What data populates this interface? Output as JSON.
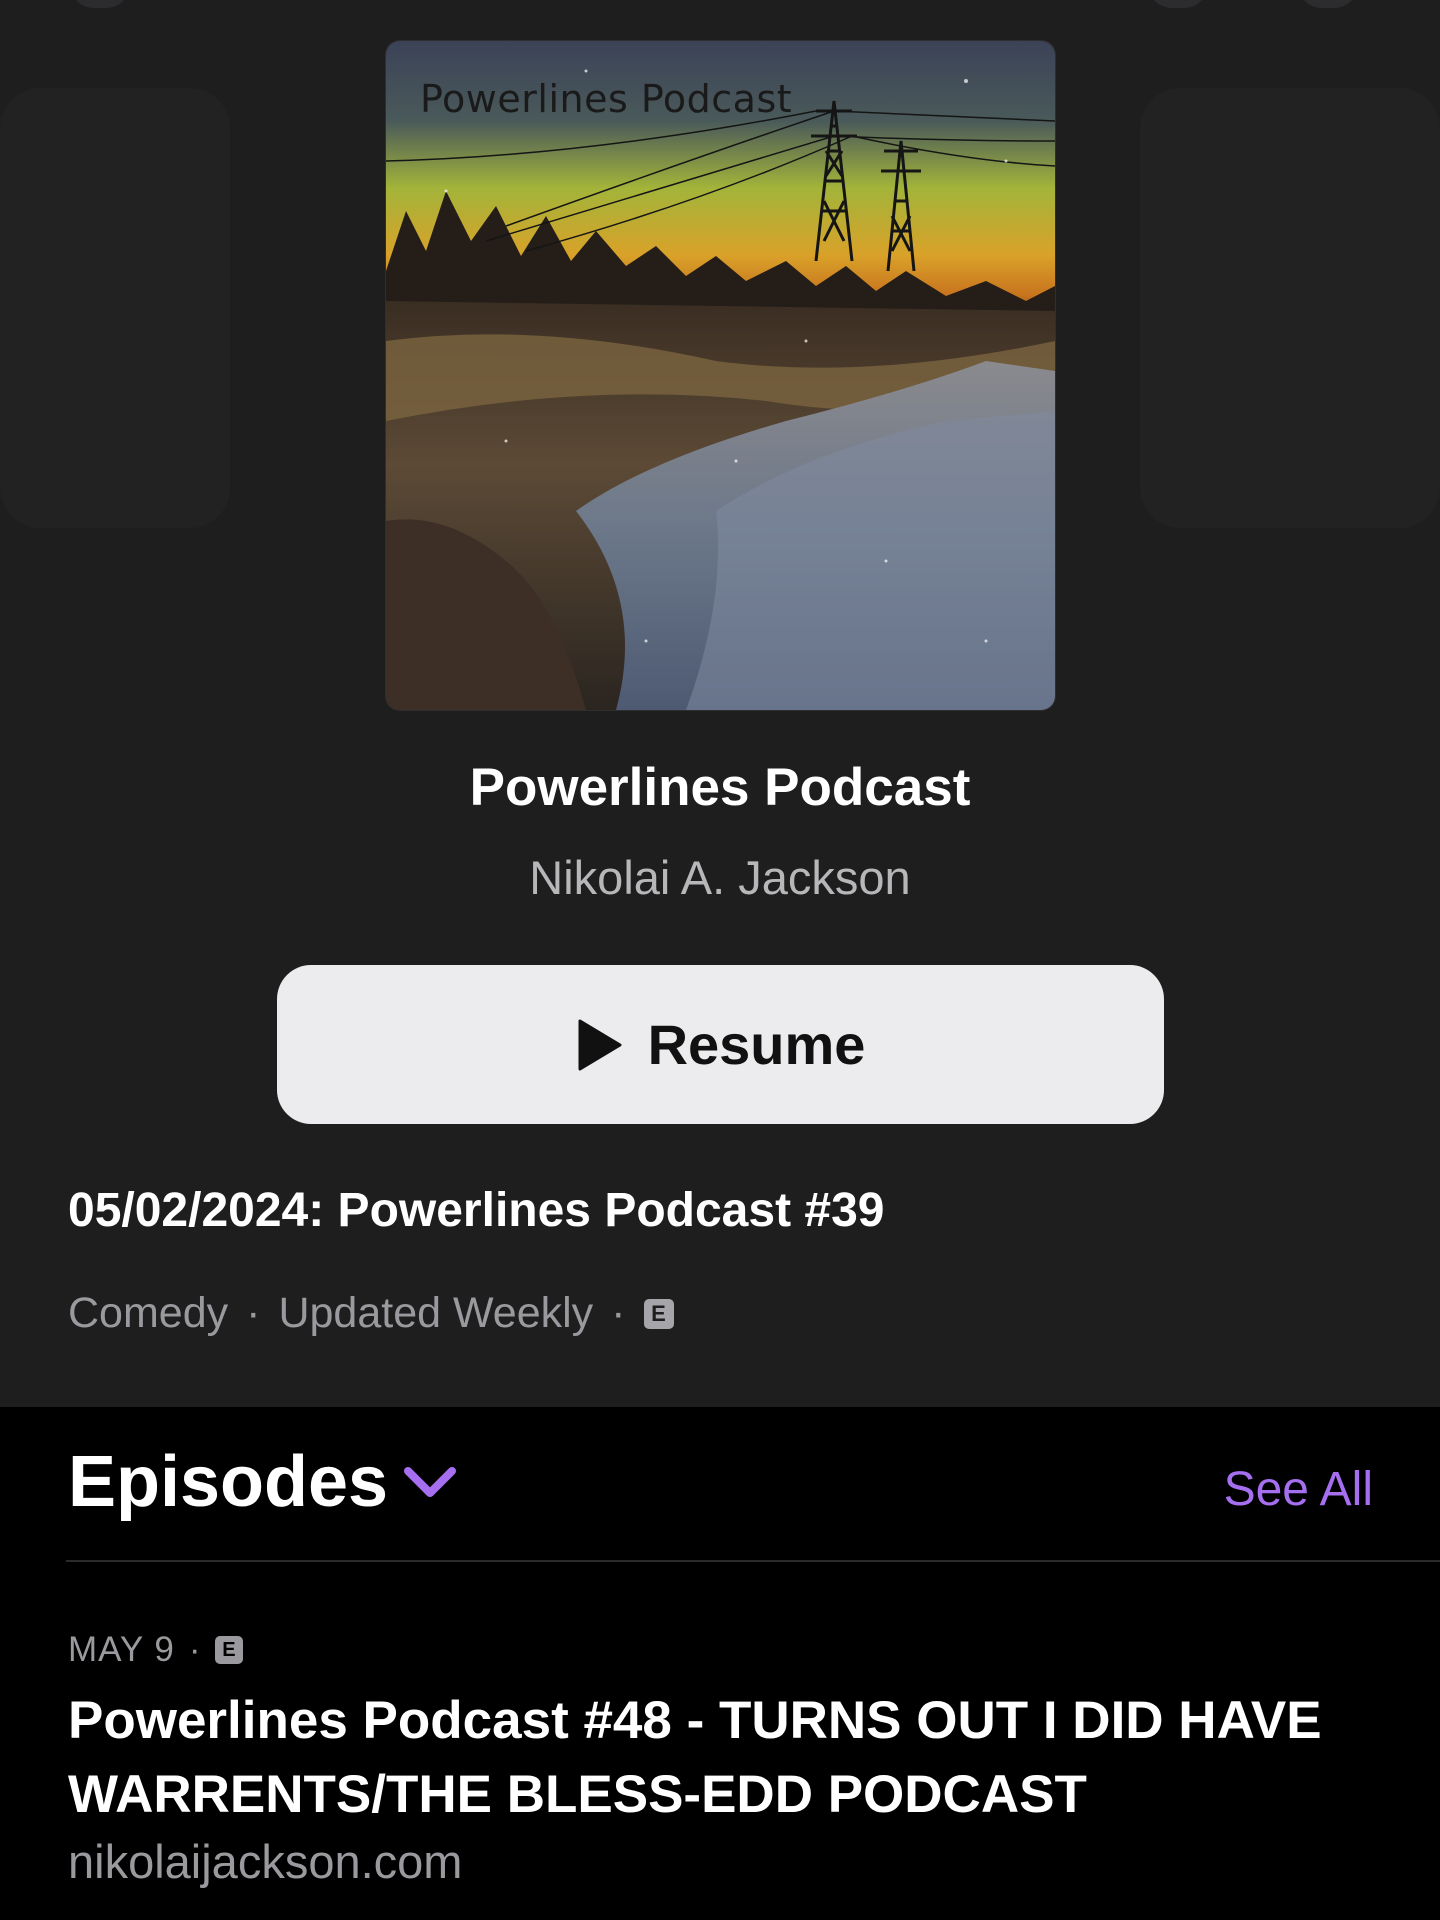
{
  "podcast": {
    "artwork_caption": "Powerlines Podcast",
    "title": "Powerlines Podcast",
    "author": "Nikolai A. Jackson"
  },
  "resume_button": {
    "label": "Resume",
    "icon": "play-icon"
  },
  "latest_episode": "05/02/2024: Powerlines Podcast #39",
  "meta": {
    "genre": "Comedy",
    "separator": "·",
    "frequency": "Updated Weekly",
    "explicit_badge": "E"
  },
  "episodes": {
    "heading": "Episodes",
    "see_all": "See All",
    "accent_color": "#a66ff0",
    "items": [
      {
        "date": "MAY 9",
        "separator": "·",
        "explicit_badge": "E",
        "title": "Powerlines Podcast #48 - TURNS OUT I DID HAVE WARRENTS/THE BLESS-EDD PODCAST",
        "description": "nikolaijackson.com"
      }
    ]
  }
}
